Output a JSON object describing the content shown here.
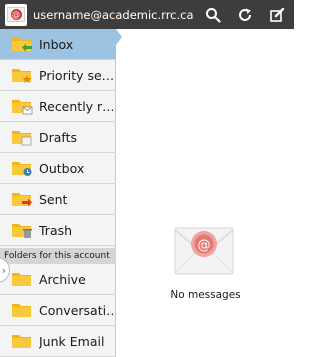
{
  "header": {
    "account": "username@academic.rrc.ca",
    "icons": [
      "email-app-icon",
      "search-icon",
      "refresh-icon",
      "compose-icon"
    ]
  },
  "folders": [
    {
      "label": "Inbox",
      "icon": "inbox-folder-icon",
      "selected": true
    },
    {
      "label": "Priority se…",
      "icon": "priority-folder-icon"
    },
    {
      "label": "Recently r…",
      "icon": "recently-read-folder-icon"
    },
    {
      "label": "Drafts",
      "icon": "drafts-folder-icon"
    },
    {
      "label": "Outbox",
      "icon": "outbox-folder-icon"
    },
    {
      "label": "Sent",
      "icon": "sent-folder-icon"
    },
    {
      "label": "Trash",
      "icon": "trash-folder-icon"
    }
  ],
  "section_header": "Folders for this account",
  "account_folders": [
    {
      "label": "Archive",
      "icon": "folder-icon"
    },
    {
      "label": "Conversati…",
      "icon": "folder-icon"
    },
    {
      "label": "Junk Email",
      "icon": "folder-icon"
    }
  ],
  "empty_state": {
    "message": "No messages",
    "icon": "empty-mailbox-icon"
  },
  "colors": {
    "topbar": "#3d3d3d",
    "selected_row": "#9cc3e2",
    "folder": "#f2b416",
    "accent_red": "#d93a33",
    "accent_green": "#3aa33a",
    "accent_blue": "#3a7fc0"
  }
}
